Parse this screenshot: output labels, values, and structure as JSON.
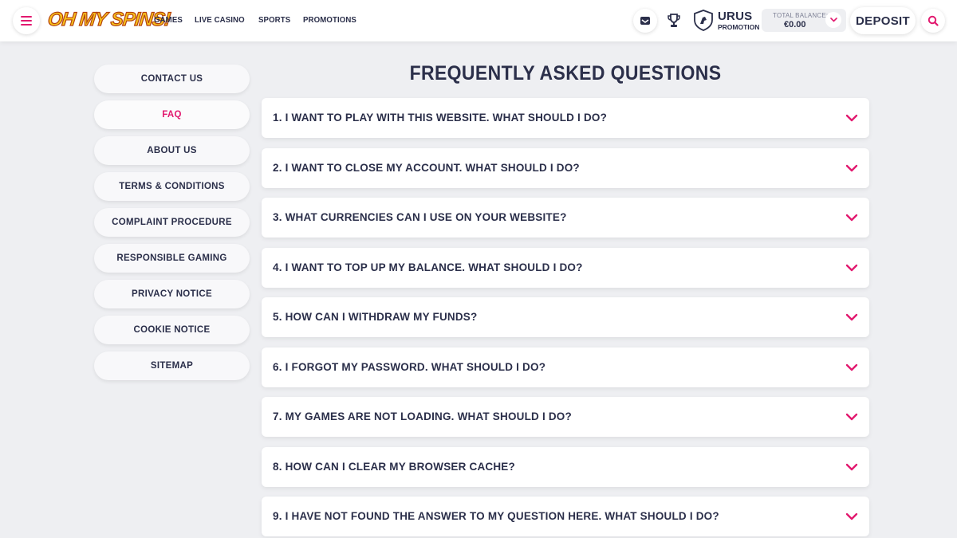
{
  "header": {
    "logo_text": "OH MY SPINS!",
    "nav": [
      "GAMES",
      "LIVE CASINO",
      "SPORTS",
      "PROMOTIONS"
    ],
    "promotion": {
      "title": "URUS",
      "subtitle": "PROMOTION"
    },
    "balance": {
      "label": "TOTAL BALANCE:",
      "value": "€0.00"
    },
    "deposit_label": "DEPOSIT",
    "icons": [
      "hamburger-menu-icon",
      "inbox-icon",
      "trophy-icon",
      "shield-logo-icon",
      "chevron-down-icon",
      "search-icon"
    ]
  },
  "sidebar": {
    "items": [
      {
        "label": "CONTACT US",
        "active": false
      },
      {
        "label": "FAQ",
        "active": true
      },
      {
        "label": "ABOUT US",
        "active": false
      },
      {
        "label": "TERMS & CONDITIONS",
        "active": false
      },
      {
        "label": "COMPLAINT PROCEDURE",
        "active": false
      },
      {
        "label": "RESPONSIBLE GAMING",
        "active": false
      },
      {
        "label": "PRIVACY NOTICE",
        "active": false
      },
      {
        "label": "COOKIE NOTICE",
        "active": false
      },
      {
        "label": "SITEMAP",
        "active": false
      }
    ]
  },
  "main": {
    "title": "FREQUENTLY ASKED QUESTIONS",
    "questions": [
      "1. I WANT TO PLAY WITH THIS WEBSITE. WHAT SHOULD I DO?",
      "2. I WANT TO CLOSE MY ACCOUNT. WHAT SHOULD I DO?",
      "3. WHAT CURRENCIES CAN I USE ON YOUR WEBSITE?",
      "4. I WANT TO TOP UP MY BALANCE. WHAT SHOULD I DO?",
      "5. HOW CAN I WITHDRAW MY FUNDS?",
      "6. I FORGOT MY PASSWORD. WHAT SHOULD I DO?",
      "7. MY GAMES ARE NOT LOADING. WHAT SHOULD I DO?",
      "8. HOW CAN I CLEAR MY BROWSER CACHE?",
      "9. I HAVE NOT FOUND THE ANSWER TO MY QUESTION HERE. WHAT SHOULD I DO?"
    ]
  },
  "colors": {
    "accent": "#e2196f",
    "text": "#2b2f4a",
    "background": "#eeeff2",
    "logo_yellow": "#f7c21b"
  }
}
